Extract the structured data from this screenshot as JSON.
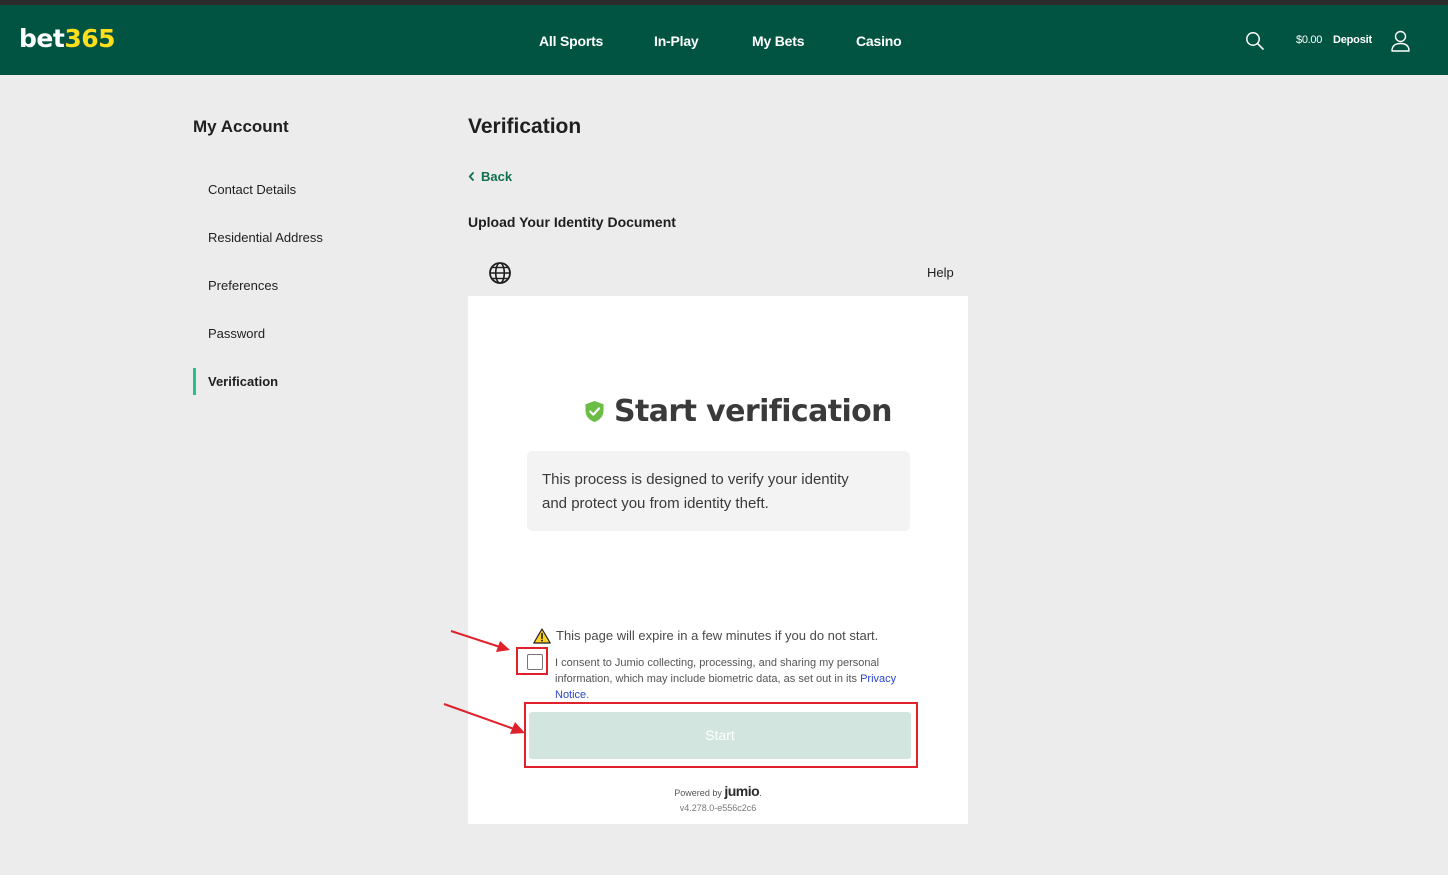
{
  "header": {
    "logo_part1": "bet",
    "logo_part2": "365",
    "nav": [
      "All Sports",
      "In-Play",
      "My Bets",
      "Casino"
    ],
    "balance": "$0.00",
    "deposit_label": "Deposit",
    "icons": [
      "search-icon",
      "user-icon"
    ]
  },
  "sidebar": {
    "title": "My Account",
    "items": [
      {
        "label": "Contact Details"
      },
      {
        "label": "Residential Address"
      },
      {
        "label": "Preferences"
      },
      {
        "label": "Password"
      },
      {
        "label": "Verification",
        "active": true
      }
    ],
    "accent_color": "#26c18f"
  },
  "main": {
    "title": "Verification",
    "back_label": "Back",
    "upload_title": "Upload Your Identity Document",
    "help_label": "Help"
  },
  "jumio": {
    "title": "Start verification",
    "info_line1": "This process is designed to verify your identity",
    "info_line2": "and protect you from identity theft.",
    "warning": "This page will expire in a few minutes if you do not start.",
    "consent_text": "I consent to Jumio collecting, processing, and sharing my personal information, which may include biometric data, as set out in its ",
    "privacy_link": "Privacy Notice",
    "consent_end": ".",
    "consent_checked": false,
    "start_label": "Start",
    "start_enabled": false,
    "powered_by": "Powered by",
    "brand": "jumio",
    "brand_dot": ".",
    "version": "v4.278.0-e556c2c6"
  },
  "colors": {
    "header_bg": "#025442",
    "logo_accent": "#ffdf1b",
    "back_link": "#126e51",
    "shield": "#6cbd45",
    "start_disabled_bg": "#d3e5df",
    "annotation_red": "#e0212b"
  }
}
